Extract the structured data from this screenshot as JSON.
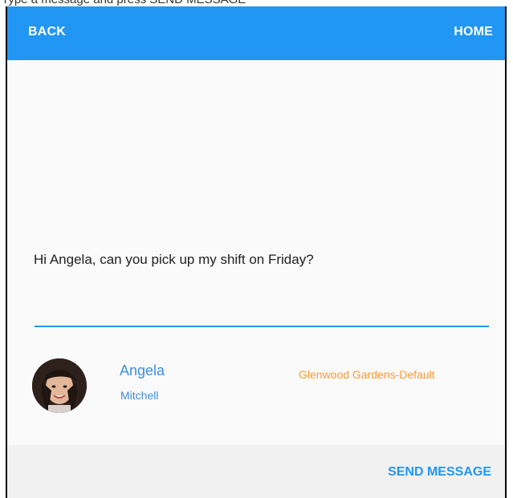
{
  "top_strip": {
    "text": "Type a message and press SEND MESSAGE"
  },
  "toolbar": {
    "back_label": "BACK",
    "home_label": "HOME",
    "color": "#2196f3"
  },
  "message": {
    "text": "Hi Angela, can you pick up my shift on Friday?"
  },
  "contact": {
    "first_name": "Angela",
    "last_name": "Mitchell",
    "location": "Glenwood Gardens-Default",
    "avatar_icon": "avatar-photo"
  },
  "footer": {
    "send_label": "SEND MESSAGE"
  },
  "colors": {
    "accent": "#2196f3",
    "location": "#ff9a2e",
    "name": "#3f8fe0"
  }
}
